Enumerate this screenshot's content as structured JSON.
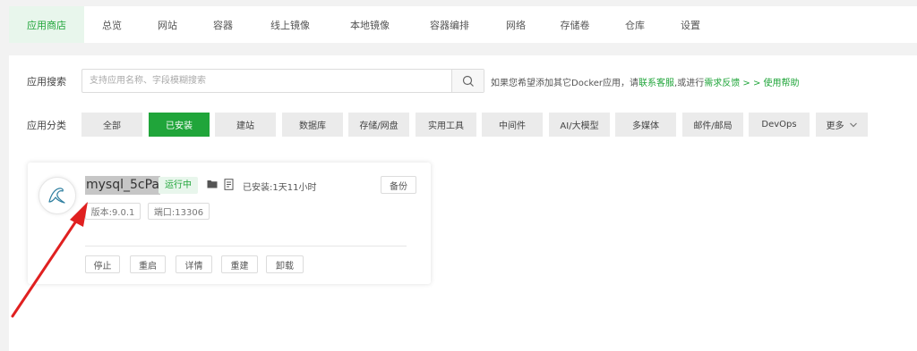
{
  "nav": {
    "tabs": [
      {
        "label": "应用商店",
        "active": true
      },
      {
        "label": "总览"
      },
      {
        "label": "网站"
      },
      {
        "label": "容器"
      },
      {
        "label": "线上镜像"
      },
      {
        "label": "本地镜像"
      },
      {
        "label": "容器编排"
      },
      {
        "label": "网络"
      },
      {
        "label": "存储卷"
      },
      {
        "label": "仓库"
      },
      {
        "label": "设置"
      }
    ]
  },
  "search": {
    "label": "应用搜索",
    "placeholder": "支持应用名称、字段模糊搜索",
    "value": "",
    "icon": "search-icon"
  },
  "hint": {
    "text_before": "如果您希望添加其它Docker应用，请",
    "link_contact": "联系客服",
    "text_middle": ",或进行",
    "link_feedback": "需求反馈",
    "link_help": " > > 使用帮助"
  },
  "categories": {
    "label": "应用分类",
    "items": [
      {
        "label": "全部"
      },
      {
        "label": "已安装",
        "active": true
      },
      {
        "label": "建站"
      },
      {
        "label": "数据库"
      },
      {
        "label": "存储/网盘"
      },
      {
        "label": "实用工具"
      },
      {
        "label": "中间件"
      },
      {
        "label": "AI/大模型"
      },
      {
        "label": "多媒体"
      },
      {
        "label": "邮件/邮局"
      },
      {
        "label": "DevOps"
      }
    ],
    "more_label": "更多"
  },
  "app_card": {
    "name": "mysql_5cPa",
    "status": "运行中",
    "installed": "已安装:1天11小时",
    "backup_label": "备份",
    "version": "版本:9.0.1",
    "port": "端口:13306",
    "actions": [
      "停止",
      "重启",
      "详情",
      "重建",
      "卸载"
    ],
    "icon": "mysql-dolphin-icon"
  },
  "colors": {
    "accent": "#20a53a",
    "accent_light": "#e8f6ec",
    "annotation_arrow": "#e02020",
    "page_bg": "#f2f2f2"
  }
}
